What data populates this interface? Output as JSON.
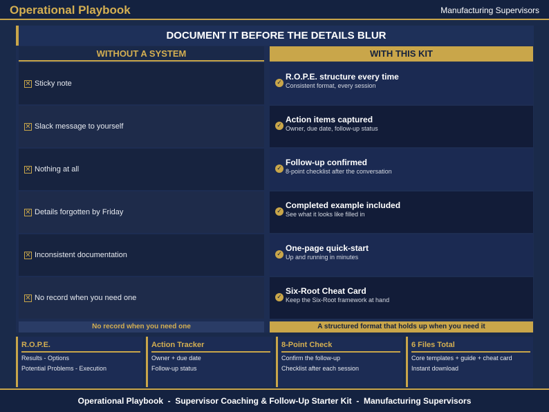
{
  "header": {
    "brand": "Operational Playbook",
    "audience": "Manufacturing Supervisors"
  },
  "main": {
    "headline": "DOCUMENT IT BEFORE THE DETAILS BLUR",
    "without": {
      "heading": "WITHOUT A SYSTEM",
      "items": [
        {
          "label": "Sticky note",
          "icon": "x-box-icon"
        },
        {
          "label": "Slack message to yourself",
          "icon": "x-box-icon"
        },
        {
          "label": "Nothing at all",
          "icon": "x-box-icon"
        },
        {
          "label": "Details forgotten by Friday",
          "icon": "x-box-icon"
        },
        {
          "label": "Inconsistent documentation",
          "icon": "x-box-icon"
        },
        {
          "label": "No record when you need one",
          "icon": "x-box-icon"
        }
      ],
      "footer": "No record when you need one"
    },
    "with": {
      "heading": "WITH THIS KIT",
      "items": [
        {
          "title": "R.O.P.E. structure every time",
          "subtitle": "Consistent format, every session",
          "icon": "check-circle-icon"
        },
        {
          "title": "Action items captured",
          "subtitle": "Owner, due date, follow-up status",
          "icon": "check-circle-icon"
        },
        {
          "title": "Follow-up confirmed",
          "subtitle": "8-point checklist after the conversation",
          "icon": "check-circle-icon"
        },
        {
          "title": "Completed example included",
          "subtitle": "See what it looks like filled in",
          "icon": "check-circle-icon"
        },
        {
          "title": "One-page quick-start",
          "subtitle": "Up and running in minutes",
          "icon": "check-circle-icon"
        },
        {
          "title": "Six-Root Cheat Card",
          "subtitle": "Keep the Six-Root framework at hand",
          "icon": "check-circle-icon"
        }
      ],
      "footer": "A structured format that holds up when you need it"
    }
  },
  "cards": [
    {
      "title": "R.O.P.E.",
      "lines": [
        "Results - Options",
        "Potential Problems - Execution"
      ]
    },
    {
      "title": "Action Tracker",
      "lines": [
        "Owner + due date",
        "Follow-up status"
      ]
    },
    {
      "title": "8-Point Check",
      "lines": [
        "Confirm the follow-up",
        "Checklist after each session"
      ]
    },
    {
      "title": "6 Files Total",
      "lines": [
        "Core templates + guide + cheat card",
        "Instant download"
      ]
    }
  ],
  "footer": {
    "text": "Operational Playbook  -  Supervisor Coaching & Follow-Up Starter Kit  -  Manufacturing Supervisors"
  },
  "colors": {
    "background": "#1a2a4a",
    "accent_gold": "#c9a64a",
    "heading_gold": "#d4af52"
  }
}
